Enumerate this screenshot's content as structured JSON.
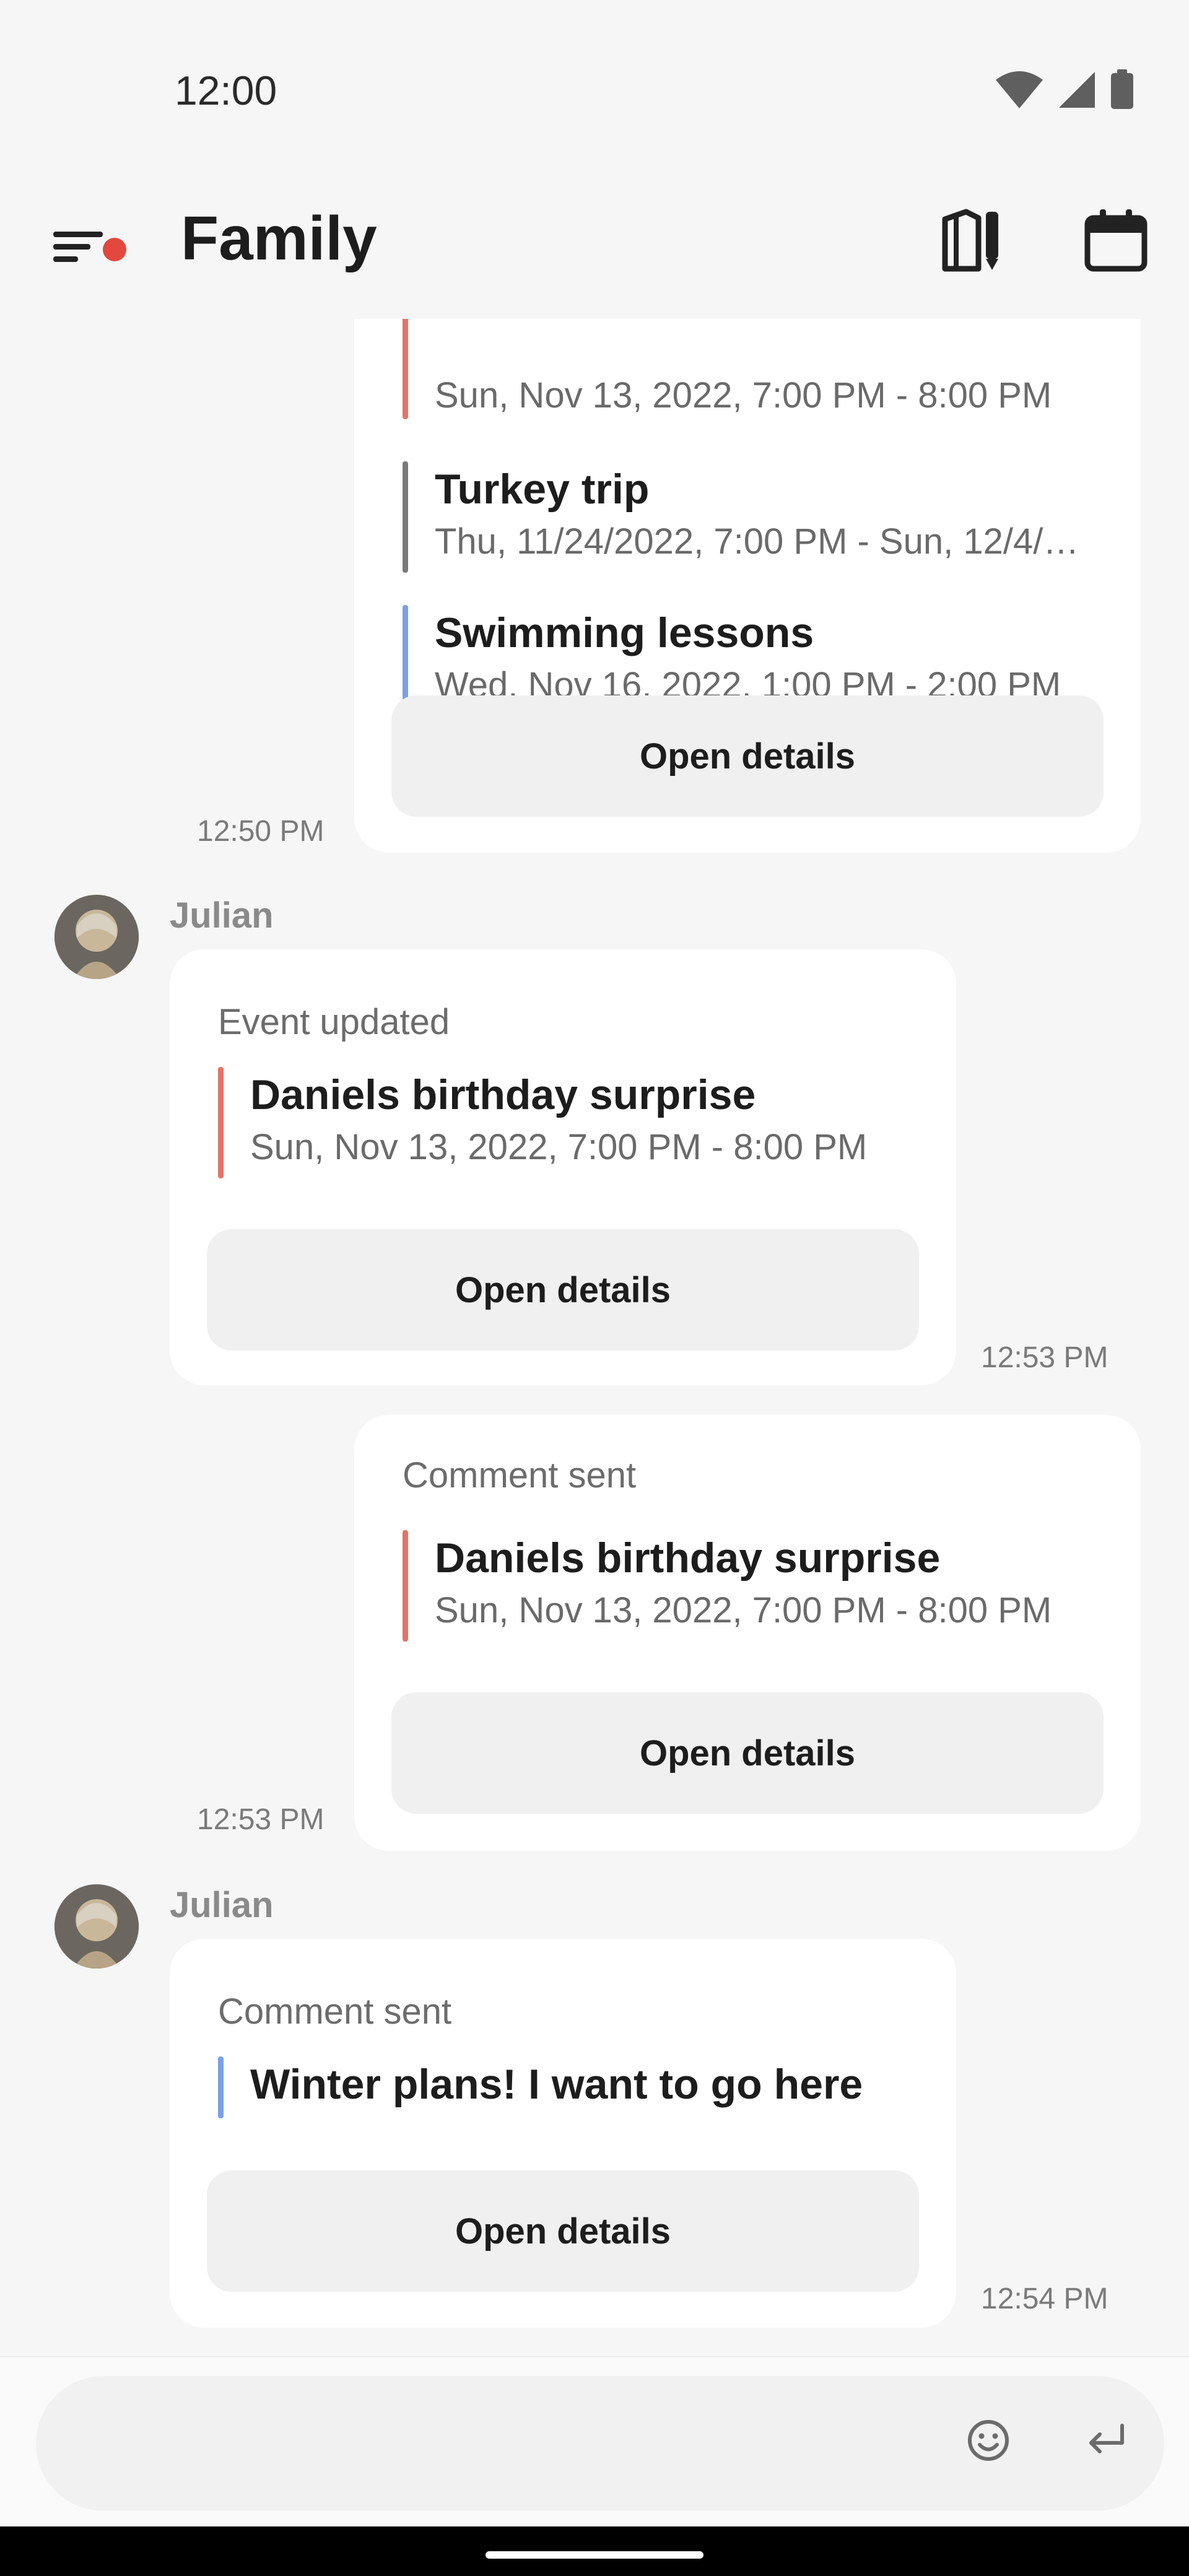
{
  "status_bar": {
    "time": "12:00"
  },
  "header": {
    "title": "Family"
  },
  "messages": [
    {
      "timestamp": "12:50 PM",
      "events": [
        {
          "subtitle": "Sun, Nov 13, 2022, 7:00 PM - 8:00 PM",
          "color": "#e57366"
        },
        {
          "title": "Turkey trip",
          "subtitle": "Thu, 11/24/2022, 7:00 PM - Sun, 12/4/…",
          "color": "#7a7a7a"
        },
        {
          "title": "Swimming lessons",
          "subtitle": "Wed, Nov 16, 2022, 1:00 PM - 2:00 PM",
          "color": "#7aa0e8"
        }
      ],
      "button_label": "Open details"
    },
    {
      "sender": "Julian",
      "caption": "Event updated",
      "timestamp": "12:53 PM",
      "event": {
        "title": "Daniels birthday surprise",
        "subtitle": "Sun, Nov 13, 2022, 7:00 PM - 8:00 PM",
        "color": "#e57366"
      },
      "button_label": "Open details"
    },
    {
      "caption": "Comment sent",
      "timestamp": "12:53 PM",
      "event": {
        "title": "Daniels birthday surprise",
        "subtitle": "Sun, Nov 13, 2022, 7:00 PM - 8:00 PM",
        "color": "#e57366"
      },
      "button_label": "Open details"
    },
    {
      "sender": "Julian",
      "caption": "Comment sent",
      "timestamp": "12:54 PM",
      "event": {
        "title": "Winter plans! I want to go here",
        "color": "#7aa0e8"
      },
      "button_label": "Open details"
    }
  ],
  "composer": {
    "placeholder": ""
  },
  "icons": [
    "menu-icon",
    "notes-icon",
    "calendar-icon",
    "wifi-icon",
    "signal-icon",
    "battery-icon",
    "emoji-icon",
    "enter-icon"
  ],
  "colors": {
    "notification_dot": "#e2483d",
    "background": "#f6f6f6",
    "card": "#ffffff",
    "button": "#f0f0f0"
  }
}
